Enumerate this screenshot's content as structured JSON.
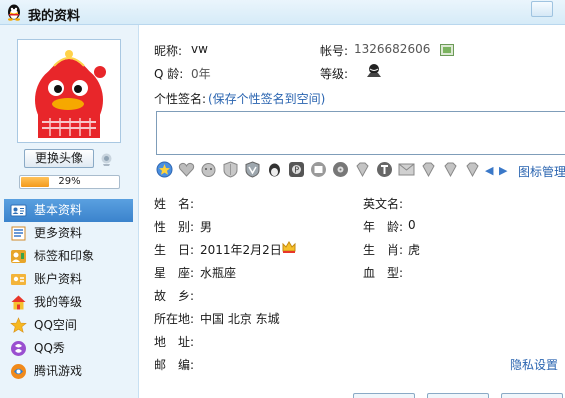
{
  "window": {
    "title": "我的资料"
  },
  "sidebar": {
    "change_avatar_label": "更换头像",
    "completion_percent": 29,
    "completion_text": "29%",
    "items": [
      {
        "label": "基本资料",
        "icon": "person-card-icon",
        "active": true
      },
      {
        "label": "更多资料",
        "icon": "document-list-icon",
        "active": false
      },
      {
        "label": "标签和印象",
        "icon": "tag-icon",
        "active": false
      },
      {
        "label": "账户资料",
        "icon": "account-icon",
        "active": false
      },
      {
        "label": "我的等级",
        "icon": "level-house-icon",
        "active": false
      },
      {
        "label": "QQ空间",
        "icon": "qzone-star-icon",
        "active": false
      },
      {
        "label": "QQ秀",
        "icon": "qqshow-icon",
        "active": false
      },
      {
        "label": "腾讯游戏",
        "icon": "tencent-game-icon",
        "active": false
      }
    ]
  },
  "profile": {
    "nickname_label": "昵称:",
    "nickname_value": "vw",
    "account_label": "帐号:",
    "account_value": "1326682606",
    "qage_label": "Q 龄:",
    "qage_value": "0年",
    "level_label": "等级:",
    "signature_label": "个性签名:",
    "signature_link": "(保存个性签名到空间)",
    "badge_manage": "图标管理",
    "privacy_link": "隐私设置"
  },
  "fields": {
    "name_label": "姓　名:",
    "name_value": "",
    "english_name_label": "英文名:",
    "english_name_value": "",
    "gender_label": "性　别:",
    "gender_value": "男",
    "age_label": "年　龄:",
    "age_value": "0",
    "birthday_label": "生　日:",
    "birthday_value": "2011年2月2日",
    "zodiac_label": "生　肖:",
    "zodiac_value": "虎",
    "constellation_label": "星　座:",
    "constellation_value": "水瓶座",
    "blood_label": "血　型:",
    "blood_value": "",
    "hometown_label": "故　乡:",
    "hometown_value": "",
    "location_label": "所在地:",
    "location_value": "中国  北京  东城",
    "address_label": "地　址:",
    "address_value": "",
    "postcode_label": "邮　编:",
    "postcode_value": ""
  },
  "colors": {
    "accent_blue": "#3b83cc",
    "link_blue": "#2a64b0",
    "progress_orange": "#f39a1c",
    "avatar_red": "#e8262a"
  }
}
